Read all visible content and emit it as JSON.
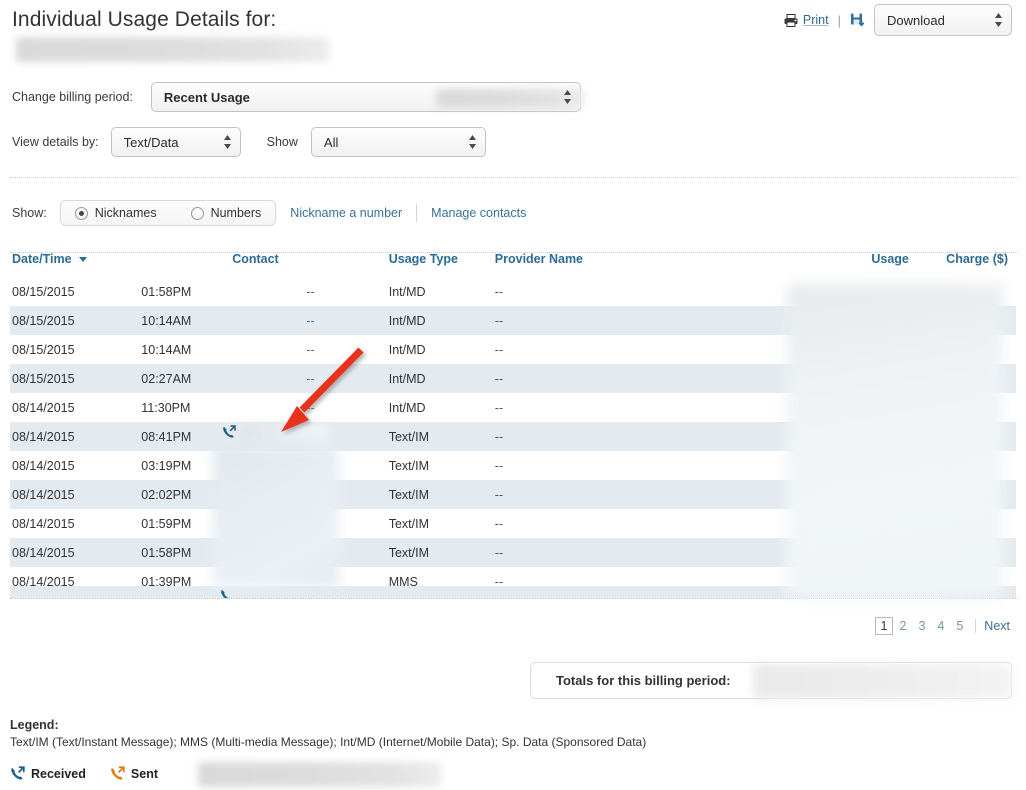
{
  "header": {
    "title": "Individual Usage Details for:",
    "account_name_redacted": true
  },
  "toolbar": {
    "print_label": "Print",
    "print_icon": "printer-icon",
    "save_icon": "floppy-disk-download-icon",
    "divider": "|",
    "download_label": "Download",
    "download_options": [
      "Download"
    ]
  },
  "filters": {
    "billing_period_label": "Change billing period:",
    "billing_period_value": "Recent Usage",
    "billing_period_options": [
      "Recent Usage"
    ],
    "view_details_label": "View details by:",
    "view_details_value": "Text/Data",
    "view_details_options": [
      "Text/Data"
    ],
    "show_label": "Show",
    "show_value": "All",
    "show_options": [
      "All"
    ]
  },
  "nickname_bar": {
    "show_label": "Show:",
    "radio_nicknames": "Nicknames",
    "radio_numbers": "Numbers",
    "selected": "Nicknames",
    "link_nickname_a_number": "Nickname a number",
    "link_manage_contacts": "Manage contacts"
  },
  "table": {
    "columns": [
      "Date/Time",
      "",
      "Contact",
      "Usage Type",
      "Provider Name",
      "Usage",
      "Charge ($)"
    ],
    "sort_column": "Date/Time",
    "sort_direction": "desc",
    "sort_icon": "caret-down-icon",
    "rows": [
      {
        "date": "08/15/2015",
        "time": "01:58PM",
        "contact": "--",
        "contact_icon": "",
        "usage_type": "Int/MD",
        "provider": "--",
        "usage": "",
        "charge": ""
      },
      {
        "date": "08/15/2015",
        "time": "10:14AM",
        "contact": "--",
        "contact_icon": "",
        "usage_type": "Int/MD",
        "provider": "--",
        "usage": "",
        "charge": ""
      },
      {
        "date": "08/15/2015",
        "time": "10:14AM",
        "contact": "--",
        "contact_icon": "",
        "usage_type": "Int/MD",
        "provider": "--",
        "usage": "",
        "charge": ""
      },
      {
        "date": "08/15/2015",
        "time": "02:27AM",
        "contact": "--",
        "contact_icon": "",
        "usage_type": "Int/MD",
        "provider": "--",
        "usage": "",
        "charge": ""
      },
      {
        "date": "08/14/2015",
        "time": "11:30PM",
        "contact": "--",
        "contact_icon": "",
        "usage_type": "Int/MD",
        "provider": "--",
        "usage": "",
        "charge": ""
      },
      {
        "date": "08/14/2015",
        "time": "08:41PM",
        "contact": "",
        "contact_icon": "received-icon",
        "usage_type": "Text/IM",
        "provider": "--",
        "usage": "",
        "charge": ""
      },
      {
        "date": "08/14/2015",
        "time": "03:19PM",
        "contact": "",
        "contact_icon": "",
        "usage_type": "Text/IM",
        "provider": "--",
        "usage": "",
        "charge": ""
      },
      {
        "date": "08/14/2015",
        "time": "02:02PM",
        "contact": "",
        "contact_icon": "",
        "usage_type": "Text/IM",
        "provider": "--",
        "usage": "",
        "charge": ""
      },
      {
        "date": "08/14/2015",
        "time": "01:59PM",
        "contact": "",
        "contact_icon": "",
        "usage_type": "Text/IM",
        "provider": "--",
        "usage": "",
        "charge": ""
      },
      {
        "date": "08/14/2015",
        "time": "01:58PM",
        "contact": "",
        "contact_icon": "",
        "usage_type": "Text/IM",
        "provider": "--",
        "usage": "",
        "charge": ""
      },
      {
        "date": "08/14/2015",
        "time": "01:39PM",
        "contact": "",
        "contact_icon": "",
        "usage_type": "MMS",
        "provider": "--",
        "usage": "",
        "charge": ""
      }
    ],
    "redactions": [
      "usage-charge-columns",
      "contact-column-rows-6-11"
    ]
  },
  "pagination": {
    "pages": [
      "1",
      "2",
      "3",
      "4",
      "5"
    ],
    "current": "1",
    "next_label": "Next"
  },
  "totals": {
    "label": "Totals for this billing period:",
    "values_redacted": true
  },
  "legend": {
    "title": "Legend:",
    "text": "Text/IM (Text/Instant Message); MMS (Multi-media Message); Int/MD (Internet/Mobile Data); Sp. Data (Sponsored Data)",
    "received_label": "Received",
    "received_icon": "received-icon",
    "received_color": "#1f5f8b",
    "sent_label": "Sent",
    "sent_icon": "sent-icon",
    "sent_color": "#e07b18"
  },
  "annotation": {
    "type": "arrow",
    "color": "#e8321a",
    "points_to": "contact-cell-row-6"
  },
  "colors": {
    "link": "#3b7193",
    "header_link": "#2c6c94",
    "row_alt": "#e4ebf0",
    "accent_red": "#e8321a"
  }
}
